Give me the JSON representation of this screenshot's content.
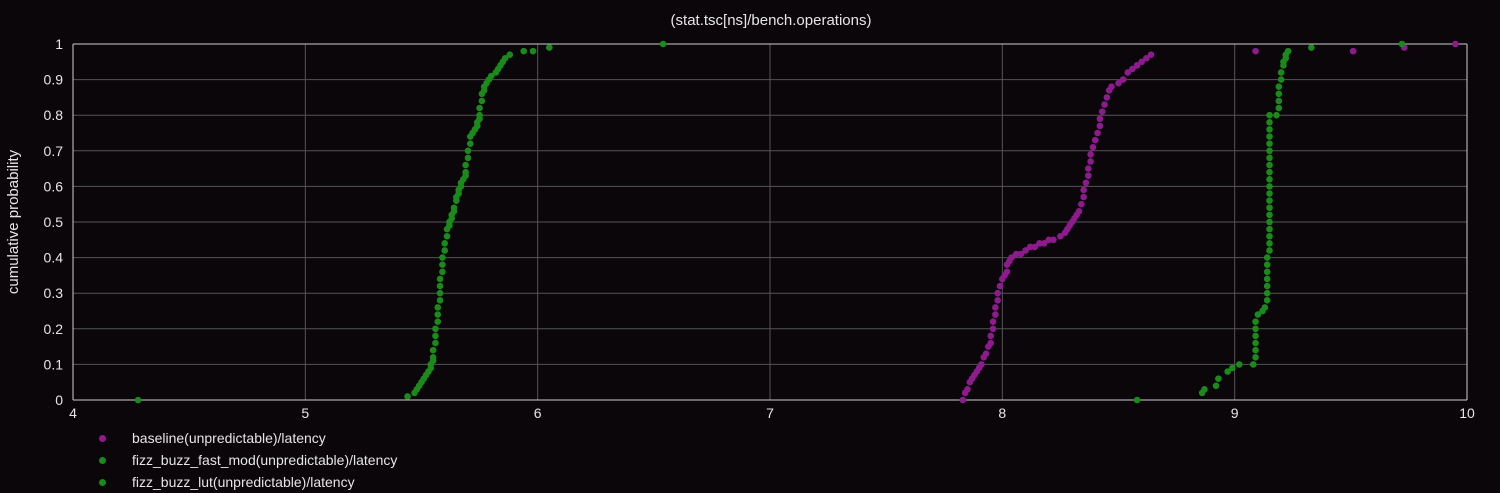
{
  "chart_data": {
    "type": "scatter",
    "title": "(stat.tsc[ns]/bench.operations)",
    "xlabel": "",
    "ylabel": "cumulative probability",
    "xlim": [
      4,
      10
    ],
    "ylim": [
      0,
      1
    ],
    "x_ticks": [
      "4",
      "5",
      "6",
      "7",
      "8",
      "9",
      "10"
    ],
    "y_ticks": [
      "0",
      "0.1",
      "0.2",
      "0.3",
      "0.4",
      "0.5",
      "0.6",
      "0.7",
      "0.8",
      "0.9",
      "1"
    ],
    "grid": true,
    "legend_position": "bottom-left",
    "background_color": "#0a060a",
    "grid_color": "#555555",
    "series": [
      {
        "name": "baseline(unpredictable)/latency",
        "color": "#8e1b8e",
        "points": [
          [
            7.83,
            0.0
          ],
          [
            7.84,
            0.02
          ],
          [
            7.85,
            0.03
          ],
          [
            7.86,
            0.05
          ],
          [
            7.87,
            0.06
          ],
          [
            7.88,
            0.07
          ],
          [
            7.89,
            0.08
          ],
          [
            7.9,
            0.09
          ],
          [
            7.91,
            0.1
          ],
          [
            7.92,
            0.12
          ],
          [
            7.93,
            0.13
          ],
          [
            7.94,
            0.15
          ],
          [
            7.95,
            0.16
          ],
          [
            7.95,
            0.18
          ],
          [
            7.96,
            0.2
          ],
          [
            7.96,
            0.22
          ],
          [
            7.97,
            0.24
          ],
          [
            7.97,
            0.26
          ],
          [
            7.98,
            0.28
          ],
          [
            7.98,
            0.3
          ],
          [
            7.99,
            0.32
          ],
          [
            8.0,
            0.34
          ],
          [
            8.01,
            0.35
          ],
          [
            8.02,
            0.36
          ],
          [
            8.02,
            0.38
          ],
          [
            8.03,
            0.39
          ],
          [
            8.04,
            0.4
          ],
          [
            8.06,
            0.41
          ],
          [
            8.08,
            0.41
          ],
          [
            8.1,
            0.42
          ],
          [
            8.12,
            0.43
          ],
          [
            8.14,
            0.43
          ],
          [
            8.16,
            0.44
          ],
          [
            8.18,
            0.44
          ],
          [
            8.2,
            0.45
          ],
          [
            8.22,
            0.45
          ],
          [
            8.25,
            0.46
          ],
          [
            8.27,
            0.47
          ],
          [
            8.28,
            0.48
          ],
          [
            8.29,
            0.49
          ],
          [
            8.3,
            0.5
          ],
          [
            8.31,
            0.51
          ],
          [
            8.32,
            0.52
          ],
          [
            8.33,
            0.53
          ],
          [
            8.34,
            0.55
          ],
          [
            8.35,
            0.57
          ],
          [
            8.35,
            0.59
          ],
          [
            8.36,
            0.61
          ],
          [
            8.37,
            0.63
          ],
          [
            8.37,
            0.65
          ],
          [
            8.38,
            0.67
          ],
          [
            8.38,
            0.69
          ],
          [
            8.39,
            0.71
          ],
          [
            8.4,
            0.73
          ],
          [
            8.41,
            0.75
          ],
          [
            8.42,
            0.77
          ],
          [
            8.42,
            0.79
          ],
          [
            8.43,
            0.81
          ],
          [
            8.44,
            0.83
          ],
          [
            8.45,
            0.85
          ],
          [
            8.46,
            0.87
          ],
          [
            8.47,
            0.88
          ],
          [
            8.5,
            0.89
          ],
          [
            8.52,
            0.9
          ],
          [
            8.54,
            0.92
          ],
          [
            8.56,
            0.93
          ],
          [
            8.58,
            0.94
          ],
          [
            8.6,
            0.95
          ],
          [
            8.62,
            0.96
          ],
          [
            8.64,
            0.97
          ],
          [
            9.09,
            0.98
          ],
          [
            9.51,
            0.98
          ],
          [
            9.73,
            0.99
          ],
          [
            9.95,
            1.0
          ]
        ]
      },
      {
        "name": "fizz_buzz_fast_mod(unpredictable)/latency",
        "color": "#1a8a1a",
        "points": [
          [
            4.28,
            0.0
          ],
          [
            5.44,
            0.01
          ],
          [
            5.47,
            0.02
          ],
          [
            5.48,
            0.03
          ],
          [
            5.49,
            0.04
          ],
          [
            5.5,
            0.05
          ],
          [
            5.51,
            0.06
          ],
          [
            5.52,
            0.07
          ],
          [
            5.53,
            0.08
          ],
          [
            5.54,
            0.09
          ],
          [
            5.54,
            0.1
          ],
          [
            5.55,
            0.11
          ],
          [
            5.55,
            0.12
          ],
          [
            5.55,
            0.14
          ],
          [
            5.56,
            0.16
          ],
          [
            5.56,
            0.18
          ],
          [
            5.56,
            0.2
          ],
          [
            5.57,
            0.22
          ],
          [
            5.57,
            0.24
          ],
          [
            5.57,
            0.26
          ],
          [
            5.58,
            0.28
          ],
          [
            5.58,
            0.3
          ],
          [
            5.58,
            0.32
          ],
          [
            5.58,
            0.34
          ],
          [
            5.59,
            0.36
          ],
          [
            5.59,
            0.38
          ],
          [
            5.59,
            0.4
          ],
          [
            5.6,
            0.42
          ],
          [
            5.6,
            0.44
          ],
          [
            5.61,
            0.46
          ],
          [
            5.61,
            0.48
          ],
          [
            5.62,
            0.49
          ],
          [
            5.62,
            0.5
          ],
          [
            5.63,
            0.51
          ],
          [
            5.63,
            0.52
          ],
          [
            5.64,
            0.53
          ],
          [
            5.64,
            0.54
          ],
          [
            5.65,
            0.56
          ],
          [
            5.65,
            0.57
          ],
          [
            5.66,
            0.58
          ],
          [
            5.66,
            0.59
          ],
          [
            5.67,
            0.6
          ],
          [
            5.67,
            0.61
          ],
          [
            5.68,
            0.62
          ],
          [
            5.69,
            0.63
          ],
          [
            5.69,
            0.64
          ],
          [
            5.69,
            0.66
          ],
          [
            5.7,
            0.68
          ],
          [
            5.7,
            0.7
          ],
          [
            5.71,
            0.72
          ],
          [
            5.71,
            0.74
          ],
          [
            5.72,
            0.75
          ],
          [
            5.73,
            0.76
          ],
          [
            5.74,
            0.77
          ],
          [
            5.74,
            0.78
          ],
          [
            5.75,
            0.79
          ],
          [
            5.75,
            0.8
          ],
          [
            5.75,
            0.82
          ],
          [
            5.76,
            0.84
          ],
          [
            5.76,
            0.86
          ],
          [
            5.77,
            0.87
          ],
          [
            5.77,
            0.88
          ],
          [
            5.78,
            0.89
          ],
          [
            5.79,
            0.9
          ],
          [
            5.8,
            0.91
          ],
          [
            5.82,
            0.92
          ],
          [
            5.83,
            0.93
          ],
          [
            5.84,
            0.94
          ],
          [
            5.85,
            0.95
          ],
          [
            5.86,
            0.96
          ],
          [
            5.88,
            0.97
          ],
          [
            5.94,
            0.98
          ],
          [
            5.98,
            0.98
          ],
          [
            6.05,
            0.99
          ],
          [
            6.54,
            1.0
          ]
        ]
      },
      {
        "name": "fizz_buzz_lut(unpredictable)/latency",
        "color": "#1a8a1a",
        "points": [
          [
            8.58,
            0.0
          ],
          [
            8.86,
            0.02
          ],
          [
            8.87,
            0.03
          ],
          [
            8.92,
            0.04
          ],
          [
            8.93,
            0.06
          ],
          [
            8.97,
            0.08
          ],
          [
            8.99,
            0.09
          ],
          [
            9.02,
            0.1
          ],
          [
            9.08,
            0.1
          ],
          [
            9.09,
            0.12
          ],
          [
            9.09,
            0.14
          ],
          [
            9.09,
            0.16
          ],
          [
            9.09,
            0.18
          ],
          [
            9.09,
            0.2
          ],
          [
            9.09,
            0.22
          ],
          [
            9.1,
            0.24
          ],
          [
            9.12,
            0.25
          ],
          [
            9.13,
            0.26
          ],
          [
            9.14,
            0.28
          ],
          [
            9.14,
            0.3
          ],
          [
            9.14,
            0.32
          ],
          [
            9.14,
            0.34
          ],
          [
            9.14,
            0.36
          ],
          [
            9.14,
            0.38
          ],
          [
            9.14,
            0.4
          ],
          [
            9.15,
            0.42
          ],
          [
            9.15,
            0.44
          ],
          [
            9.15,
            0.46
          ],
          [
            9.15,
            0.48
          ],
          [
            9.15,
            0.5
          ],
          [
            9.15,
            0.52
          ],
          [
            9.15,
            0.54
          ],
          [
            9.15,
            0.56
          ],
          [
            9.15,
            0.58
          ],
          [
            9.15,
            0.6
          ],
          [
            9.15,
            0.62
          ],
          [
            9.15,
            0.64
          ],
          [
            9.15,
            0.66
          ],
          [
            9.15,
            0.68
          ],
          [
            9.15,
            0.7
          ],
          [
            9.15,
            0.72
          ],
          [
            9.15,
            0.74
          ],
          [
            9.15,
            0.76
          ],
          [
            9.15,
            0.78
          ],
          [
            9.15,
            0.8
          ],
          [
            9.18,
            0.8
          ],
          [
            9.19,
            0.82
          ],
          [
            9.19,
            0.84
          ],
          [
            9.19,
            0.86
          ],
          [
            9.19,
            0.88
          ],
          [
            9.2,
            0.9
          ],
          [
            9.2,
            0.92
          ],
          [
            9.21,
            0.94
          ],
          [
            9.21,
            0.95
          ],
          [
            9.22,
            0.96
          ],
          [
            9.22,
            0.97
          ],
          [
            9.23,
            0.98
          ],
          [
            9.33,
            0.99
          ],
          [
            9.72,
            1.0
          ]
        ]
      }
    ]
  }
}
